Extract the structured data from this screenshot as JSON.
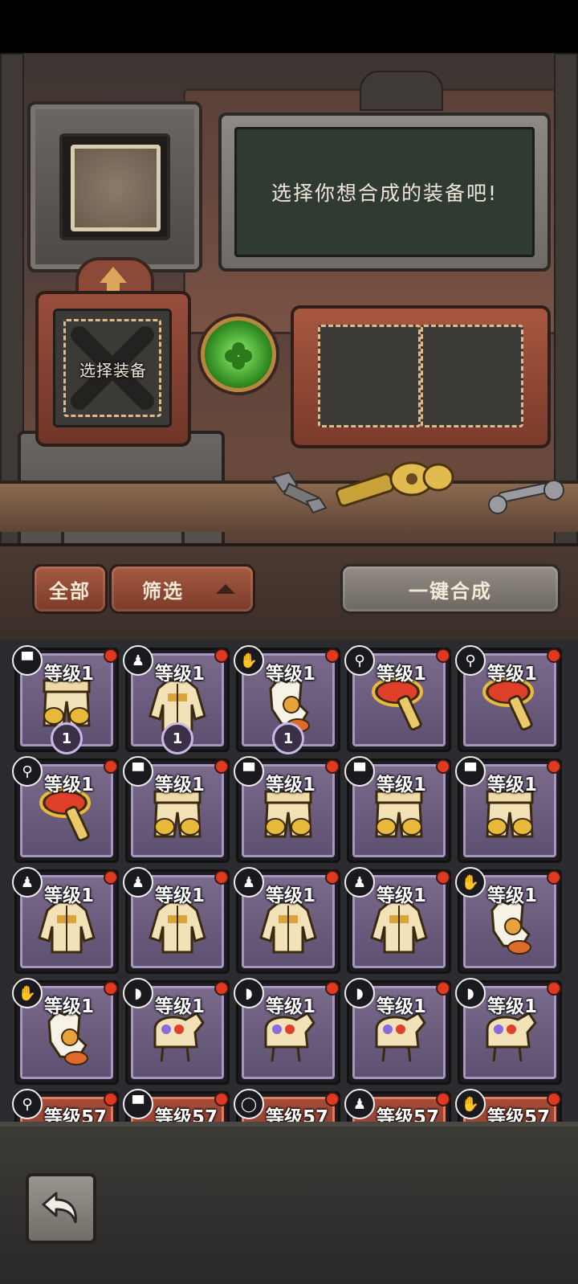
{
  "workshop": {
    "message": "选择你想合成的装备吧!",
    "select_label": "选择装备"
  },
  "toolbar": {
    "all_label": "全部",
    "filter_label": "筛选",
    "craft_label": "一键合成"
  },
  "grid": {
    "items": [
      {
        "type": "pants-icon",
        "glyph": "▀",
        "level": "等级1",
        "count": "1",
        "item": "pants",
        "style": "purple"
      },
      {
        "type": "coat-icon",
        "glyph": "♟",
        "level": "等级1",
        "count": "1",
        "item": "coat",
        "style": "purple"
      },
      {
        "type": "glove-icon",
        "glyph": "✋",
        "level": "等级1",
        "count": "1",
        "item": "glove",
        "style": "purple"
      },
      {
        "type": "tool-icon",
        "glyph": "⚲",
        "level": "等级1",
        "count": "",
        "item": "tool",
        "style": "purple"
      },
      {
        "type": "tool-icon",
        "glyph": "⚲",
        "level": "等级1",
        "count": "",
        "item": "tool",
        "style": "purple"
      },
      {
        "type": "tool-icon",
        "glyph": "⚲",
        "level": "等级1",
        "count": "",
        "item": "tool",
        "style": "purple"
      },
      {
        "type": "pants-icon",
        "glyph": "▀",
        "level": "等级1",
        "count": "",
        "item": "pants",
        "style": "purple"
      },
      {
        "type": "pants-icon",
        "glyph": "▀",
        "level": "等级1",
        "count": "",
        "item": "pants",
        "style": "purple"
      },
      {
        "type": "pants-icon",
        "glyph": "▀",
        "level": "等级1",
        "count": "",
        "item": "pants",
        "style": "purple"
      },
      {
        "type": "pants-icon",
        "glyph": "▀",
        "level": "等级1",
        "count": "",
        "item": "pants",
        "style": "purple"
      },
      {
        "type": "coat-icon",
        "glyph": "♟",
        "level": "等级1",
        "count": "",
        "item": "coat",
        "style": "purple"
      },
      {
        "type": "coat-icon",
        "glyph": "♟",
        "level": "等级1",
        "count": "",
        "item": "coat",
        "style": "purple"
      },
      {
        "type": "coat-icon",
        "glyph": "♟",
        "level": "等级1",
        "count": "",
        "item": "coat",
        "style": "purple"
      },
      {
        "type": "coat-icon",
        "glyph": "♟",
        "level": "等级1",
        "count": "",
        "item": "coat",
        "style": "purple"
      },
      {
        "type": "glove-icon",
        "glyph": "✋",
        "level": "等级1",
        "count": "",
        "item": "glove",
        "style": "purple"
      },
      {
        "type": "glove-icon",
        "glyph": "✋",
        "level": "等级1",
        "count": "",
        "item": "glove",
        "style": "purple"
      },
      {
        "type": "boot-icon",
        "glyph": "◗",
        "level": "等级1",
        "count": "",
        "item": "boot",
        "style": "purple"
      },
      {
        "type": "boot-icon",
        "glyph": "◗",
        "level": "等级1",
        "count": "",
        "item": "boot",
        "style": "purple"
      },
      {
        "type": "boot-icon",
        "glyph": "◗",
        "level": "等级1",
        "count": "",
        "item": "boot",
        "style": "purple"
      },
      {
        "type": "boot-icon",
        "glyph": "◗",
        "level": "等级1",
        "count": "",
        "item": "boot",
        "style": "purple"
      },
      {
        "type": "tool-icon",
        "glyph": "⚲",
        "level": "等级57",
        "count": "",
        "item": "tool",
        "style": "red"
      },
      {
        "type": "pants-icon",
        "glyph": "▀",
        "level": "等级57",
        "count": "",
        "item": "pants",
        "style": "red"
      },
      {
        "type": "ring-icon",
        "glyph": "◯",
        "level": "等级57",
        "count": "",
        "item": "ring",
        "style": "red"
      },
      {
        "type": "coat-icon",
        "glyph": "♟",
        "level": "等级57",
        "count": "",
        "item": "coat",
        "style": "red"
      },
      {
        "type": "glove-icon",
        "glyph": "✋",
        "level": "等级57",
        "count": "",
        "item": "glove",
        "style": "red"
      }
    ]
  },
  "colors": {
    "accent_green": "#5fd046",
    "badge_red": "#e0391f",
    "card_purple": "#6e5f82",
    "card_red": "#943f30"
  }
}
